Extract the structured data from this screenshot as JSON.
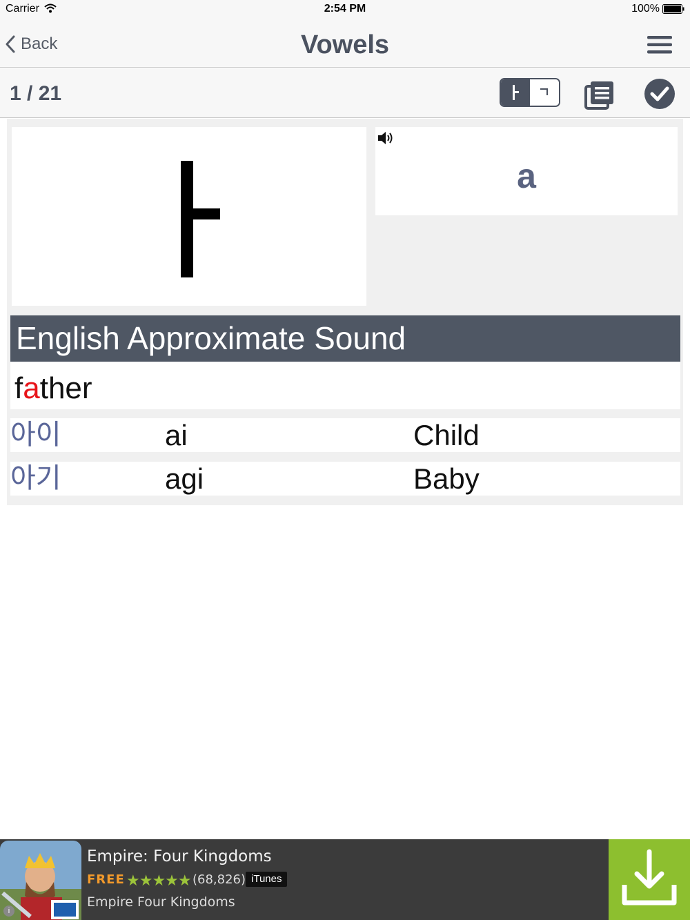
{
  "status_bar": {
    "carrier": "Carrier",
    "time": "2:54 PM",
    "battery": "100%"
  },
  "nav": {
    "back_label": "Back",
    "title": "Vowels"
  },
  "toolbar": {
    "page_counter": "1 / 21",
    "toggle_left": "ㅏ",
    "toggle_right": "ㄱ"
  },
  "card": {
    "glyph": "ㅏ",
    "romanization": "a"
  },
  "section": {
    "header": "English Approximate Sound",
    "example_prefix": "f",
    "example_highlight": "a",
    "example_suffix": "ther"
  },
  "vocab": [
    {
      "korean": "아이",
      "roman": "ai",
      "english": "Child"
    },
    {
      "korean": "아기",
      "roman": "agi",
      "english": "Baby"
    }
  ],
  "ad": {
    "title": "Empire: Four Kingdoms",
    "price": "FREE",
    "stars": "★★★★★",
    "rating_count": "(68,826)",
    "store": "iTunes",
    "developer": "Empire Four Kingdoms"
  },
  "colors": {
    "accent": "#4b5260",
    "highlight": "#e8141a",
    "korean_text": "#5a6699",
    "ad_download": "#8dbf2f"
  }
}
